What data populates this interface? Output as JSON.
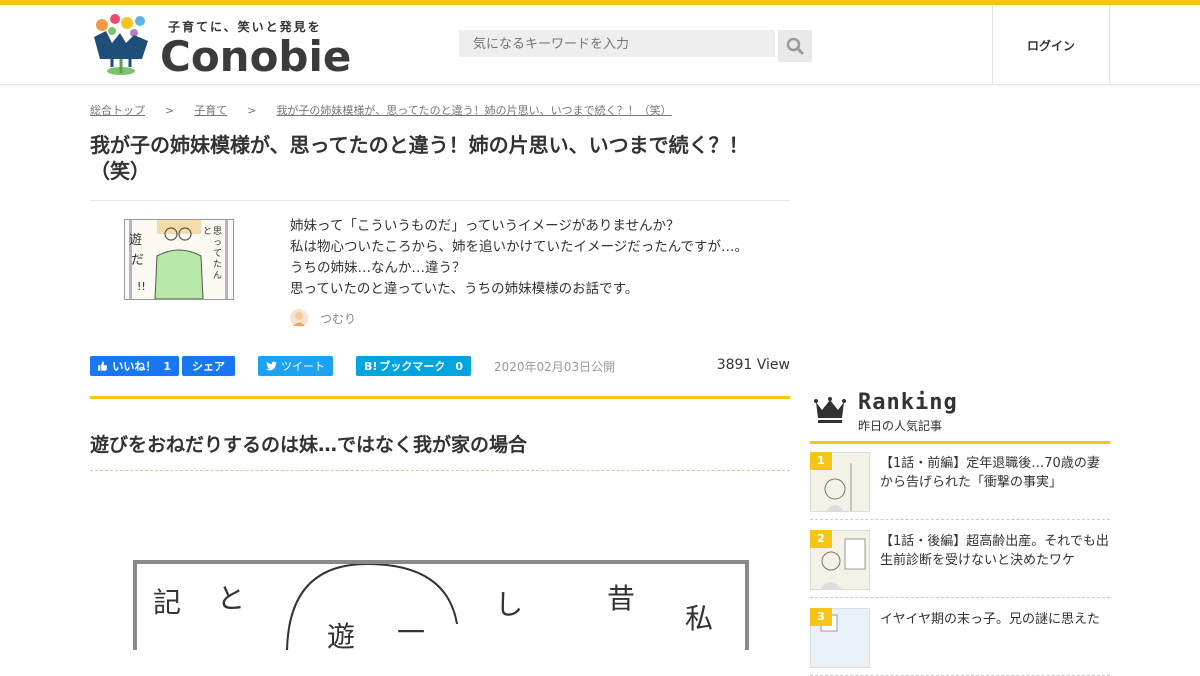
{
  "brand": {
    "tagline": "子育てに、笑いと発見を",
    "name": "Conobie",
    "accent": "#f5c518"
  },
  "header": {
    "search_placeholder": "気になるキーワードを入力",
    "search_icon": "search-icon",
    "login_label": "ログイン"
  },
  "breadcrumb": {
    "items": [
      "総合トップ",
      "子育て",
      "我が子の姉妹模様が、思ってたのと違う！姉の片思い、いつまで続く？！（笑）"
    ],
    "separator": ">"
  },
  "article": {
    "title": "我が子の姉妹模様が、思ってたのと違う！姉の片思い、いつまで続く？！（笑）",
    "intro": [
      "姉妹って「こういうものだ」っていうイメージがありませんか？",
      "私は物心ついたころから、姉を追いかけていたイメージだったんですが…。",
      "うちの姉妹…なんか…違う？",
      "思っていたのと違っていた、うちの姉妹模様のお話です。"
    ],
    "author": "つむり",
    "thumb_text": [
      "遊",
      "だ",
      "!!",
      "思",
      "っ",
      "て",
      "た",
      "ん",
      "と"
    ],
    "published": "2020年02月03日公開",
    "views": "3891 View",
    "section_heading": "遊びをおねだりするのは妹…ではなく我が家の場合",
    "comic_text": [
      "記",
      "と",
      "遊",
      "一",
      "し",
      "昔",
      "私"
    ]
  },
  "social": {
    "like_label": "いいね！",
    "like_count": "1",
    "share_label": "シェア",
    "tweet_label": "ツイート",
    "hatena_label": "ブックマーク",
    "hatena_count": "0",
    "fb_color": "#1877f2",
    "tw_color": "#1da1f2",
    "hb_color": "#00a4de"
  },
  "ranking": {
    "title": "Ranking",
    "subtitle": "昨日の人気記事",
    "items": [
      {
        "rank": "1",
        "text": "【1話・前編】定年退職後…70歳の妻から告げられた「衝撃の事実」"
      },
      {
        "rank": "2",
        "text": "【1話・後編】超高齢出産。それでも出生前診断を受けないと決めたワケ"
      },
      {
        "rank": "3",
        "text": "イヤイヤ期の末っ子。兄の謎に思えた"
      }
    ]
  }
}
